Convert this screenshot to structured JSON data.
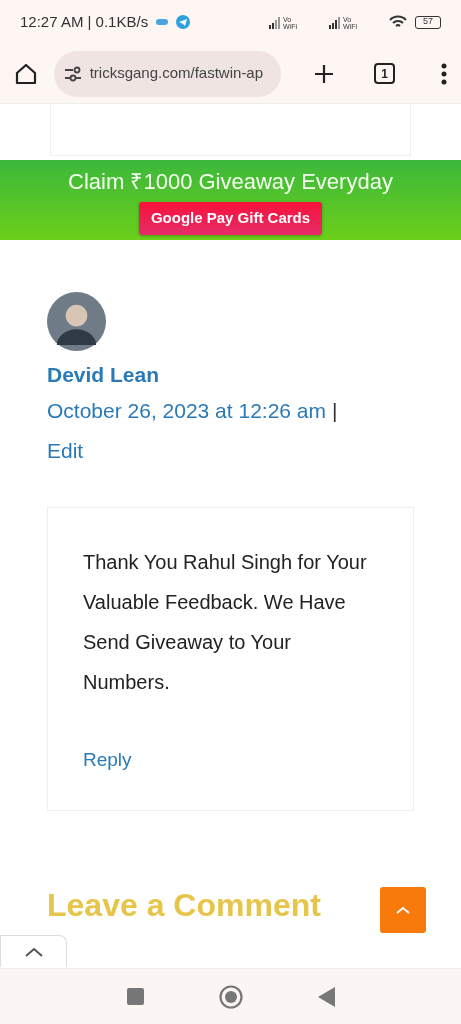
{
  "status_bar": {
    "time": "12:27 AM | 0.1KB/s",
    "battery": "57",
    "sim_labels": [
      {
        "top": "Vo",
        "bottom": "WiFi"
      },
      {
        "top": "Vo",
        "bottom": "WiFi"
      }
    ]
  },
  "browser": {
    "url": "tricksgang.com/fastwin-ap",
    "tab_count": "1"
  },
  "banner": {
    "headline": "Claim ₹1000 Giveaway Everyday",
    "button": "Google Pay Gift Cards"
  },
  "comment": {
    "author": "Devid Lean",
    "date": "October 26, 2023 at 12:26 am",
    "separator": "|",
    "edit": "Edit",
    "text": "Thank You Rahul Singh for Your Valuable Feedback. We Have Send Giveaway to Your Numbers.",
    "reply": "Reply"
  },
  "leave_comment": {
    "title": "Leave a Comment"
  }
}
